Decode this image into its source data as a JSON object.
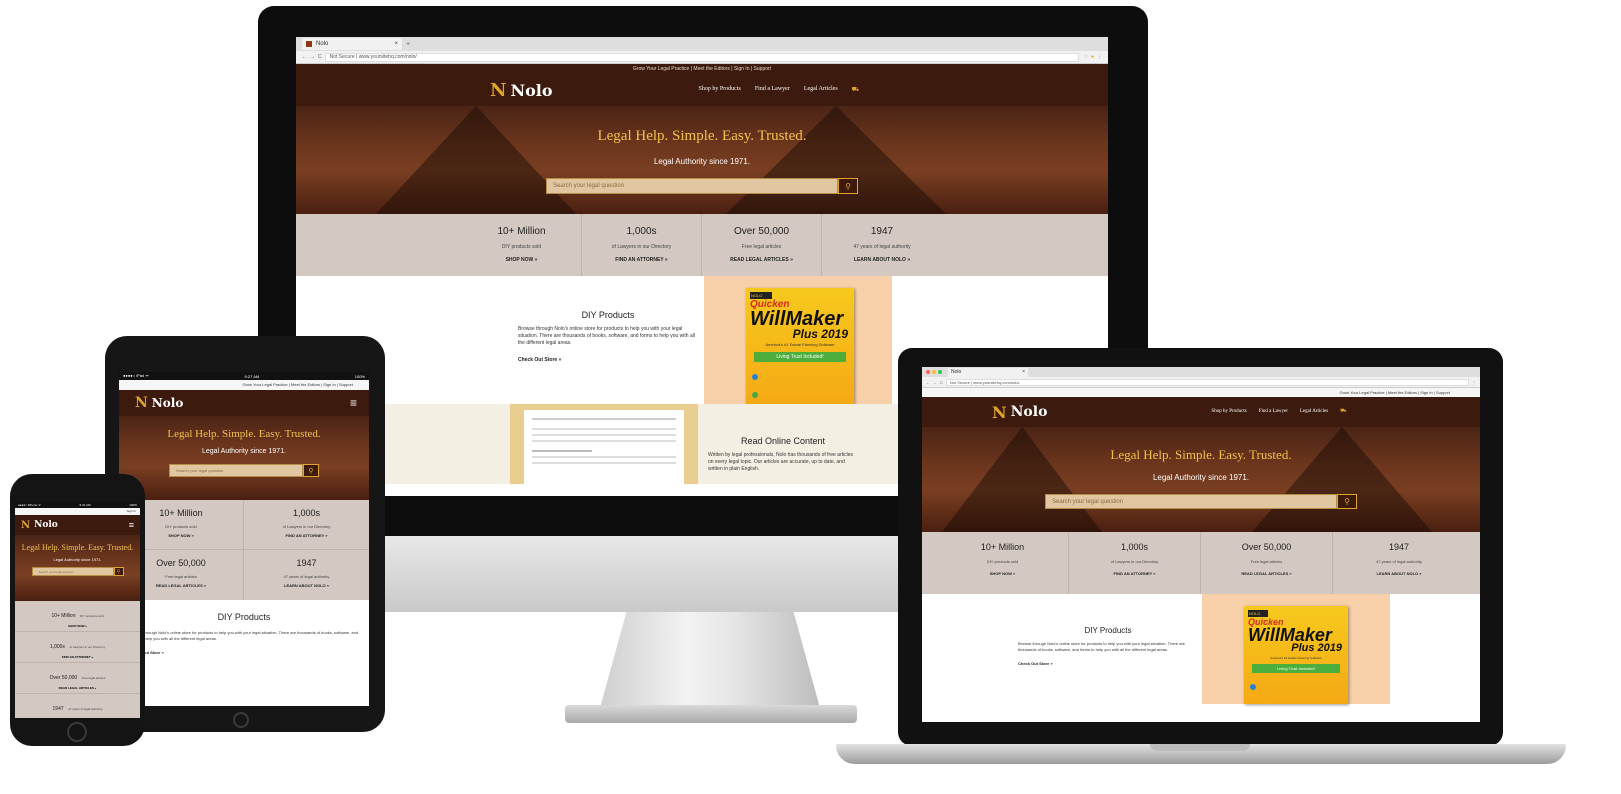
{
  "brand": {
    "name": "Nolo",
    "mark": "N"
  },
  "browser": {
    "tab_title": "Nolo",
    "url": "Not Secure  |  www.yoursitehq.com/nolo/",
    "laptop_url": "Not Secure  |  www.yoursitehq.com/nolo/",
    "close": "×",
    "new_tab": "+"
  },
  "topbar": "Grow Your Legal Practice | Meet the Editors | Sign In | Support",
  "nav": {
    "shop": "Shop by Products",
    "find": "Find a Lawyer",
    "articles": "Legal Articles",
    "cart_icon": "cart-icon"
  },
  "hero": {
    "title": "Legal Help.  Simple.  Easy.  Trusted.",
    "phone_title": "Legal Help. Simple. Easy. Trusted.",
    "subtitle": "Legal Authority since 1971.",
    "search_placeholder": "Search your legal question",
    "search_icon": "search-icon"
  },
  "stats": [
    {
      "big": "10+ Million",
      "small": "DIY products sold",
      "link": "SHOP NOW »"
    },
    {
      "big": "1,000s",
      "small": "of Lawyers in our Directory",
      "link": "FIND AN ATTORNEY »"
    },
    {
      "big": "Over 50,000",
      "small": "Free legal articles",
      "link": "READ LEGAL ARTICLES »"
    },
    {
      "big": "1947",
      "small": "47 years of legal authority",
      "link": "LEARN ABOUT NOLO »"
    }
  ],
  "diy": {
    "title": "DIY Products",
    "body": "Browse through Nolo's online store for products to help you with your legal situation. There are thousands of books, software, and forms to help you with all the different legal areas.",
    "link": "Check Out Store »"
  },
  "product": {
    "brand_tag": "NOLO",
    "quicken": "Quicken",
    "willmaker": "WillMaker",
    "plus": "Plus 2019",
    "tagline": "America's #1 Estate Planning Software",
    "button": "Living Trust Included!"
  },
  "read": {
    "title": "Read Online Content",
    "body": "Written by legal professionals, Nolo has thousands of free articles on every legal topic. Our articles are accurate, up to date, and written in plain English."
  },
  "tablet_status": {
    "left": "●●●●○ iPad ᯤ",
    "time": "9:27 AM",
    "battery": "100%"
  },
  "phone_status": {
    "left": "●●●●○ iPhone ᯤ",
    "time": "9:41 AM",
    "battery": "100%"
  },
  "phone_topbar": "Sign In",
  "menu_icon": "menu-icon"
}
